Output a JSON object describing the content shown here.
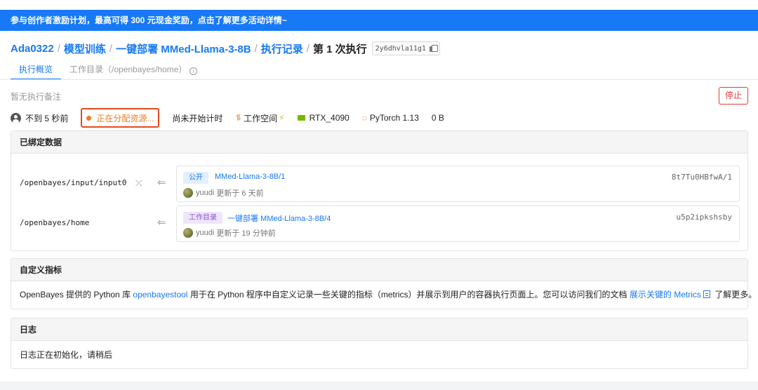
{
  "banner": {
    "text": "参与创作者激励计划，最高可得 300 元现金奖励，点击了解更多活动详情~"
  },
  "breadcrumb": {
    "user": "Ada0322",
    "project": "模型训练",
    "task": "一键部署 MMed-Llama-3-8B",
    "records": "执行记录",
    "current": "第 1 次执行",
    "run_id": "2y6dhvla11g1",
    "separator": "/"
  },
  "tabs": {
    "overview": "执行概览",
    "workdir": "工作目录（/openbayes/home）",
    "info_glyph": "i"
  },
  "note": "暂无执行备注",
  "stop_button": "停止",
  "status": {
    "time": "不到 5 秒前",
    "allocating": "正在分配资源...",
    "timer": "尚未开始计时",
    "workspace": "工作空间",
    "gpu": "RTX_4090",
    "framework": "PyTorch 1.13",
    "size": "0 B"
  },
  "bound_data": {
    "title": "已绑定数据",
    "rows": [
      {
        "path": "/openbayes/input/input0",
        "tag": "公开",
        "name": "MMed-Llama-3-8B/1",
        "hash": "8t7Tu0HBfwA/1",
        "user": "yuudi",
        "updated": "更新于 6 天前"
      },
      {
        "path": "/openbayes/home",
        "tag": "工作目录",
        "name": "一键部署 MMed-Llama-3-8B/4",
        "hash": "u5p2ipkshsby",
        "user": "yuudi",
        "updated": "更新于 19 分钟前"
      }
    ]
  },
  "metrics": {
    "title": "自定义指标",
    "text_1": "OpenBayes 提供的 Python 库 ",
    "link_1": "openbayestool",
    "text_2": " 用于在 Python 程序中自定义记录一些关键的指标（metrics）并展示到用户的容器执行页面上。您可以访问我们的文档 ",
    "link_2": "展示关键的 Metrics",
    "text_3": " 了解更多。"
  },
  "logs": {
    "title": "日志",
    "text": "日志正在初始化，请稍后"
  },
  "colors": {
    "primary": "#1779f5",
    "danger": "#e53935",
    "warning": "#f07b1e",
    "nvidia": "#76b900"
  },
  "icons": [
    "user-icon",
    "dot-icon",
    "workspace-icon",
    "bolt-icon",
    "nvidia-icon",
    "pytorch-icon",
    "copy-icon",
    "unlink-icon",
    "arrow-left-icon",
    "avatar",
    "doc-icon",
    "info-icon"
  ]
}
